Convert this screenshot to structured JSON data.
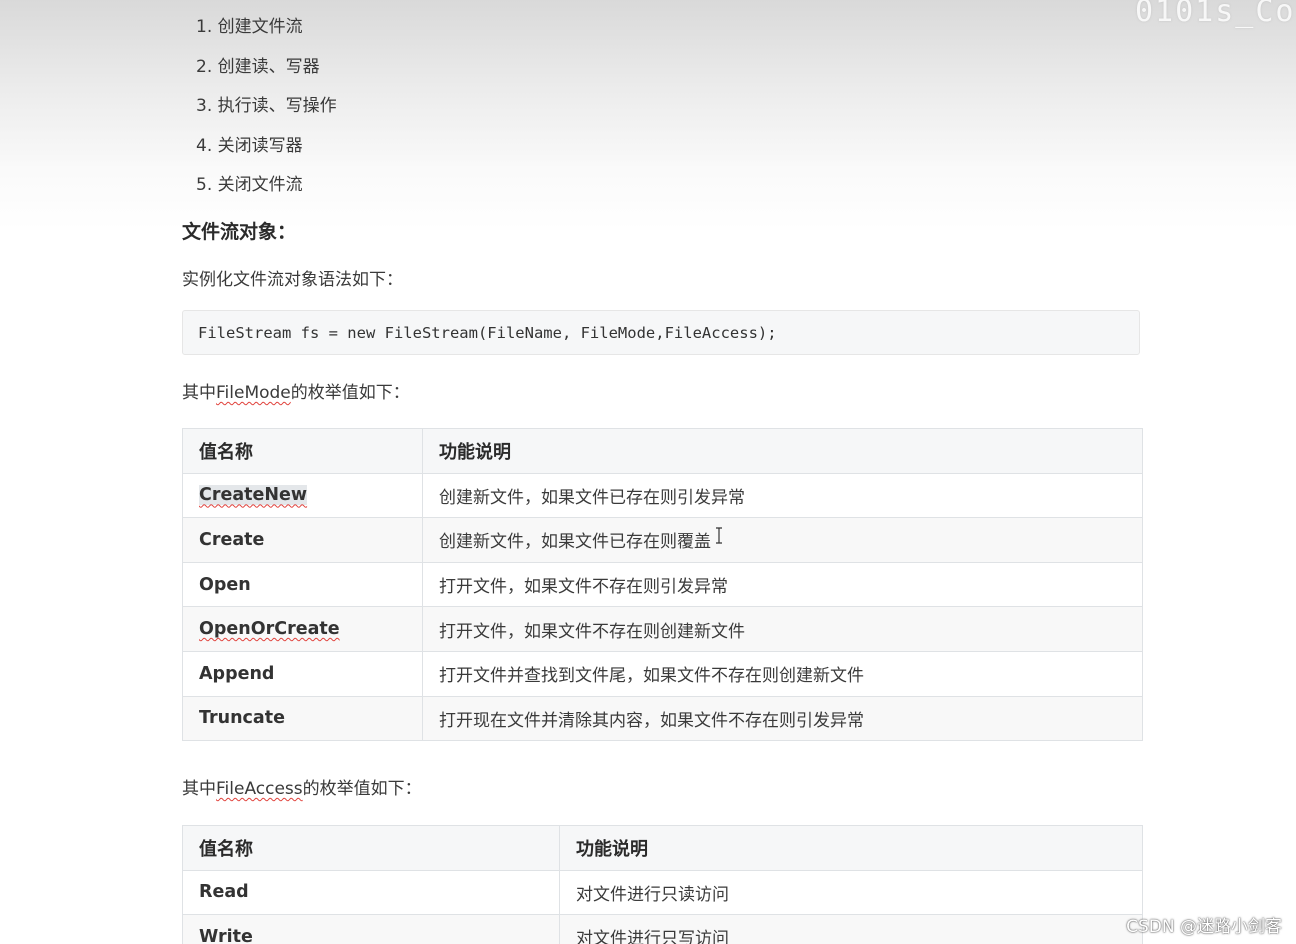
{
  "steps": [
    "1. 创建文件流",
    "2. 创建读、写器",
    "3. 执行读、写操作",
    "4. 关闭读写器",
    "5. 关闭文件流"
  ],
  "heading": "文件流对象：",
  "syntax_intro": "实例化文件流对象语法如下：",
  "code": "FileStream fs = new FileStream(FileName, FileMode,FileAccess);",
  "filemode_intro": {
    "prefix": "其中",
    "term": "FileMode",
    "suffix": "的枚举值如下："
  },
  "filemode_table": {
    "headers": [
      "值名称",
      "功能说明"
    ],
    "rows": [
      {
        "name": "CreateNew",
        "desc": "创建新文件，如果文件已存在则引发异常"
      },
      {
        "name": "Create",
        "desc": "创建新文件，如果文件已存在则覆盖"
      },
      {
        "name": "Open",
        "desc": "打开文件，如果文件不存在则引发异常"
      },
      {
        "name": "OpenOrCreate",
        "desc": "打开文件，如果文件不存在则创建新文件"
      },
      {
        "name": "Append",
        "desc": "打开文件并查找到文件尾，如果文件不存在则创建新文件"
      },
      {
        "name": "Truncate",
        "desc": "打开现在文件并清除其内容，如果文件不存在则引发异常"
      }
    ]
  },
  "fileaccess_intro": {
    "prefix": "其中",
    "term": "FileAccess",
    "suffix": "的枚举值如下："
  },
  "fileaccess_table": {
    "headers": [
      "值名称",
      "功能说明"
    ],
    "rows": [
      {
        "name": "Read",
        "desc": "对文件进行只读访问"
      },
      {
        "name": "Write",
        "desc": "对文件进行只写访问"
      }
    ]
  },
  "watermark": "CSDN @迷路小剑客",
  "top_watermark": "0101s_Co"
}
